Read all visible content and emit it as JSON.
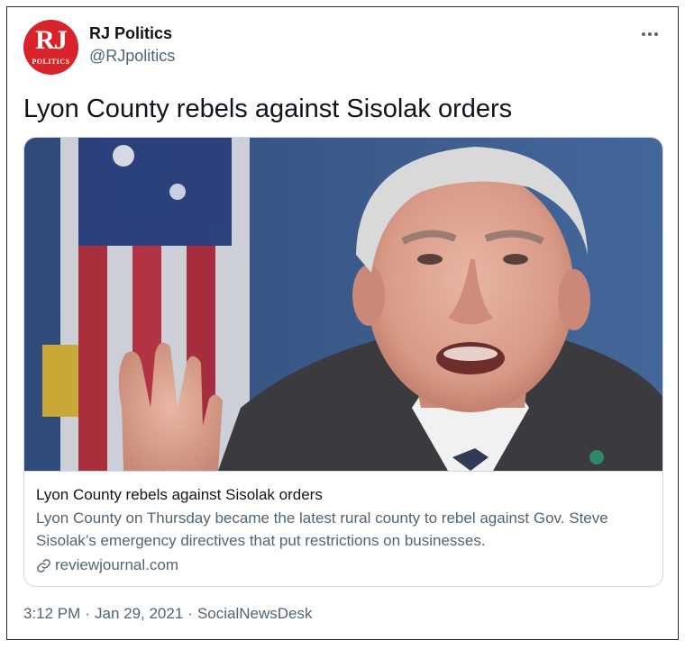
{
  "account": {
    "name": "RJ Politics",
    "handle": "@RJpolitics",
    "avatar_letters": "RJ",
    "avatar_subtext": "POLITICS",
    "avatar_color": "#d8232a"
  },
  "tweet": {
    "text": "Lyon County rebels against Sisolak orders"
  },
  "card": {
    "title": "Lyon County rebels against Sisolak orders",
    "description": "Lyon County on Thursday became the latest rural county to rebel against Gov. Steve Sisolak’s emergency directives that put restrictions on businesses.",
    "domain": "reviewjournal.com",
    "image_icon": "photo-of-speaker-with-flag"
  },
  "meta": {
    "time": "3:12 PM",
    "separator": "·",
    "date": "Jan 29, 2021",
    "source": "SocialNewsDesk"
  },
  "icons": {
    "more": "more-options-icon",
    "link": "link-icon"
  },
  "colors": {
    "text_primary": "#0f1419",
    "text_secondary": "#536471",
    "border": "#cfd9de"
  }
}
